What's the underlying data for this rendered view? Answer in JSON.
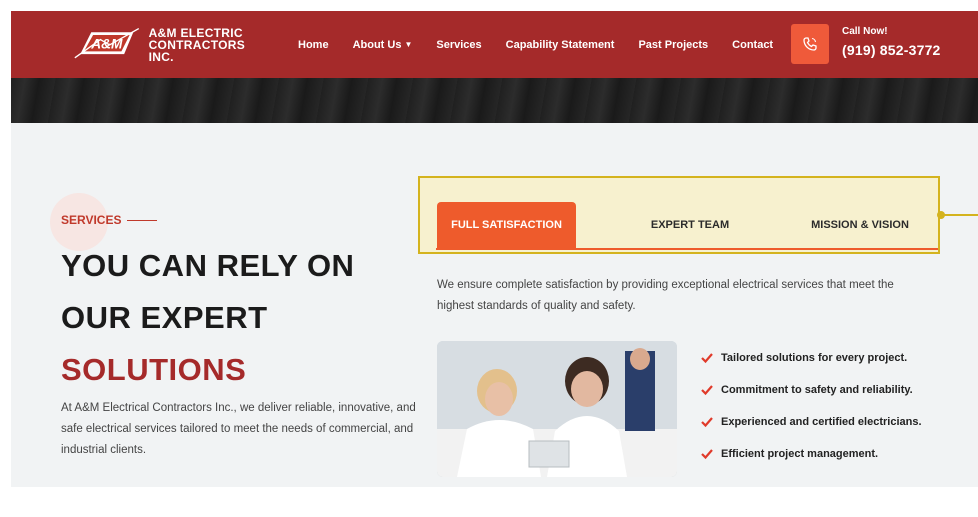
{
  "header": {
    "logo_text_line1": "A&M ELECTRIC",
    "logo_text_line2": "CONTRACTORS INC.",
    "nav": [
      {
        "label": "Home"
      },
      {
        "label": "About Us"
      },
      {
        "label": "Services"
      },
      {
        "label": "Capability Statement"
      },
      {
        "label": "Past Projects"
      },
      {
        "label": "Contact"
      }
    ],
    "call_label": "Call Now!",
    "call_number": "(919) 852-3772",
    "icons": {
      "phone": "phone-icon",
      "about_caret": "chevron-down-icon"
    }
  },
  "hero": {
    "section_tag": "SERVICES",
    "headline_line1": "YOU CAN RELY ON",
    "headline_line2": "OUR EXPERT",
    "headline_line3": "SOLUTIONS",
    "intro": "At A&M Electrical Contractors Inc., we deliver reliable, innovative, and safe electrical services tailored to meet the needs of commercial, and industrial clients."
  },
  "tabs": {
    "items": [
      {
        "label": "FULL SATISFACTION",
        "active": true
      },
      {
        "label": "EXPERT TEAM",
        "active": false
      },
      {
        "label": "MISSION & VISION",
        "active": false
      }
    ],
    "description": "We ensure complete satisfaction by providing exceptional electrical services that meet the highest standards of quality and safety.",
    "checklist": [
      "Tailored solutions for every project.",
      "Commitment to safety and reliability.",
      "Experienced and certified electricians.",
      "Efficient project management."
    ]
  },
  "colors": {
    "header_bg": "#a52a2a",
    "accent_orange": "#ee5b2c",
    "highlight_yellow": "#d4b31e",
    "headline_red": "#a52a2a"
  }
}
